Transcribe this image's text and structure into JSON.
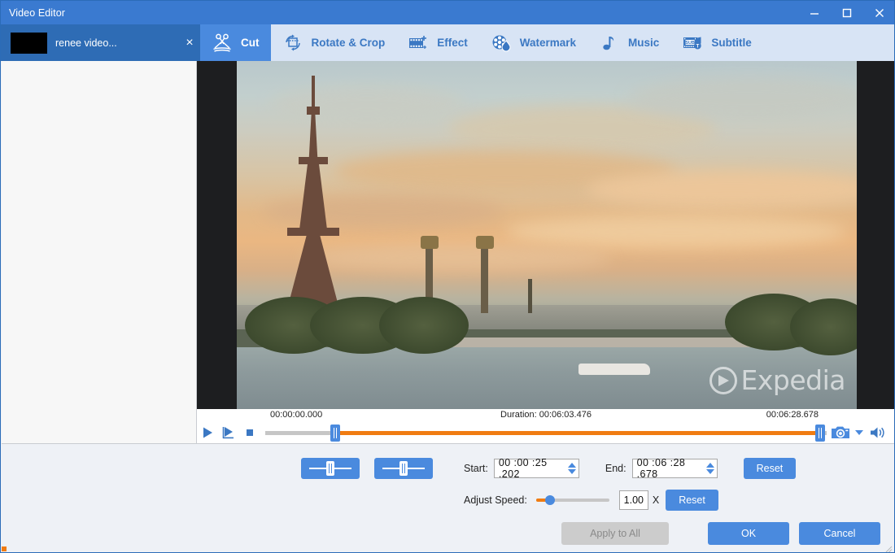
{
  "window": {
    "title": "Video Editor",
    "controls": [
      {
        "name": "minimize",
        "glyph": "minimize-icon"
      },
      {
        "name": "maximize",
        "glyph": "maximize-icon"
      },
      {
        "name": "close",
        "glyph": "close-icon"
      }
    ]
  },
  "file_tab": {
    "name": "renee video...",
    "close_label": "×"
  },
  "toolbar": {
    "items": [
      {
        "label": "Cut",
        "icon": "scissors-icon",
        "active": true
      },
      {
        "label": "Rotate & Crop",
        "icon": "rotate-crop-icon",
        "active": false
      },
      {
        "label": "Effect",
        "icon": "film-sparkle-icon",
        "active": false
      },
      {
        "label": "Watermark",
        "icon": "watermark-icon",
        "active": false
      },
      {
        "label": "Music",
        "icon": "music-note-icon",
        "active": false
      },
      {
        "label": "Subtitle",
        "icon": "subtitle-icon",
        "active": false
      }
    ]
  },
  "preview": {
    "watermark_text": "Expedia"
  },
  "timeline": {
    "start_time": "00:00:00.000",
    "duration_label": "Duration: 00:06:03.476",
    "end_time": "00:06:28.678",
    "controls": {
      "play": "play-icon",
      "play_selection": "play-selection-icon",
      "stop": "stop-icon",
      "snapshot": "camera-icon",
      "snapshot_menu": "chevron-down-icon",
      "volume": "volume-icon"
    }
  },
  "cut_panel": {
    "set_start_label": "",
    "set_end_label": "",
    "start_label": "Start:",
    "start_value": "00 :00 :25 .202",
    "end_label": "End:",
    "end_value": "00 :06 :28 .678",
    "reset_trim_label": "Reset",
    "speed_label": "Adjust Speed:",
    "speed_value": "1.00",
    "speed_unit": "X",
    "reset_speed_label": "Reset"
  },
  "actions": {
    "apply_to_all": "Apply to All",
    "ok": "OK",
    "cancel": "Cancel"
  },
  "colors": {
    "titlebar": "#3a7ad0",
    "tab_active": "#4a8ade",
    "tabstrip": "#d8e4f5",
    "accent_orange": "#f07c12",
    "panel": "#eef1f6"
  }
}
